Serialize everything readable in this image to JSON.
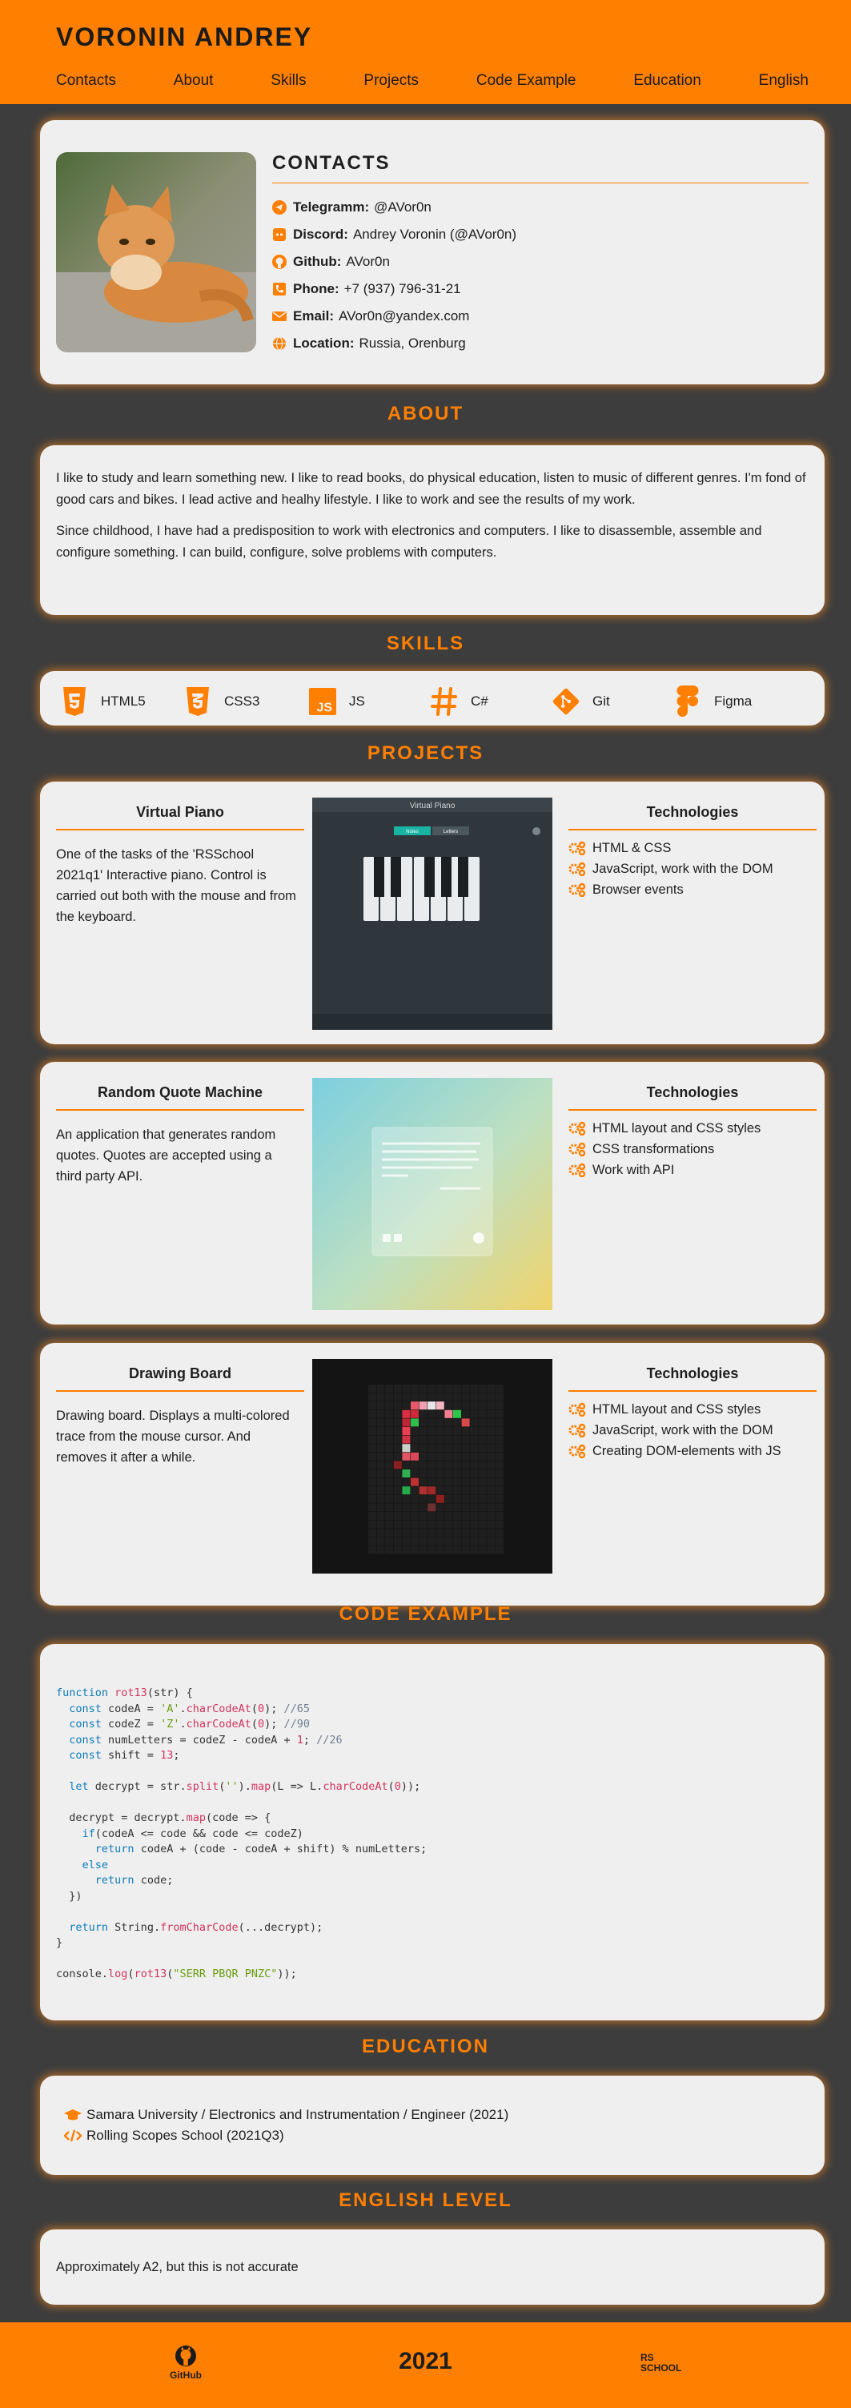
{
  "header": {
    "name": "VORONIN ANDREY",
    "nav": [
      "Contacts",
      "About",
      "Skills",
      "Projects",
      "Code Example",
      "Education",
      "English"
    ]
  },
  "contacts": {
    "title": "CONTACTS",
    "items": [
      {
        "icon": "telegram-icon",
        "label": "Telegramm:",
        "value": "@AVor0n"
      },
      {
        "icon": "discord-icon",
        "label": "Discord:",
        "value": "Andrey Voronin (@AVor0n)"
      },
      {
        "icon": "github-icon",
        "label": "Github:",
        "value": "AVor0n"
      },
      {
        "icon": "phone-icon",
        "label": "Phone:",
        "value": "+7 (937) 796-31-21"
      },
      {
        "icon": "email-icon",
        "label": "Email:",
        "value": "AVor0n@yandex.com"
      },
      {
        "icon": "location-icon",
        "label": "Location:",
        "value": "Russia, Orenburg"
      }
    ]
  },
  "about": {
    "title": "ABOUT",
    "paragraphs": [
      "I like to study and learn something new. I like to read books, do physical education, listen to music of different genres. I'm fond of good cars and bikes. I lead active and healhy lifestyle. I like to work and see the results of my work.",
      "Since childhood, I have had a predisposition to work with electronics and computers. I like to disassemble, assemble and configure something. I can build, configure, solve problems with computers."
    ]
  },
  "skills": {
    "title": "SKILLS",
    "items": [
      {
        "icon": "html5-icon",
        "label": "HTML5"
      },
      {
        "icon": "css3-icon",
        "label": "CSS3"
      },
      {
        "icon": "js-icon",
        "label": "JS"
      },
      {
        "icon": "csharp-icon",
        "label": "C#"
      },
      {
        "icon": "git-icon",
        "label": "Git"
      },
      {
        "icon": "figma-icon",
        "label": "Figma"
      }
    ]
  },
  "projects": {
    "title": "PROJECTS",
    "tech_title": "Technologies",
    "items": [
      {
        "name": "Virtual Piano",
        "description": "One of the tasks of the 'RSSchool 2021q1' Interactive piano. Control is carried out both with the mouse and from the keyboard.",
        "screenshot": {
          "title": "Virtual Piano",
          "btn1": "Notes",
          "btn2": "Letters"
        },
        "tech": [
          "HTML & CSS",
          "JavaScript, work with the DOM",
          "Browser events"
        ]
      },
      {
        "name": "Random Quote Machine",
        "description": "An application that generates random quotes. Quotes are accepted using a third party API.",
        "tech": [
          "HTML layout and CSS styles",
          "CSS transformations",
          "Work with API"
        ]
      },
      {
        "name": "Drawing Board",
        "description": "Drawing board. Displays a multi-colored trace from the mouse cursor. And removes it after a while.",
        "tech": [
          "HTML layout and CSS styles",
          "JavaScript, work with the DOM",
          "Creating DOM-elements with JS"
        ]
      }
    ]
  },
  "code": {
    "title": "CODE EXAMPLE"
  },
  "education": {
    "title": "EDUCATION",
    "items": [
      "Samara University / Electronics and Instrumentation / Engineer (2021)",
      "Rolling Scopes School (2021Q3)"
    ]
  },
  "english": {
    "title": "ENGLISH LEVEL",
    "text": "Approximately A2, but this is not accurate"
  },
  "footer": {
    "github_label": "GitHub",
    "year": "2021",
    "school_logo_text": "RS SCHOOL"
  },
  "colors": {
    "accent": "#ff7f00",
    "background": "#3d3d3d",
    "card": "#efefef"
  }
}
